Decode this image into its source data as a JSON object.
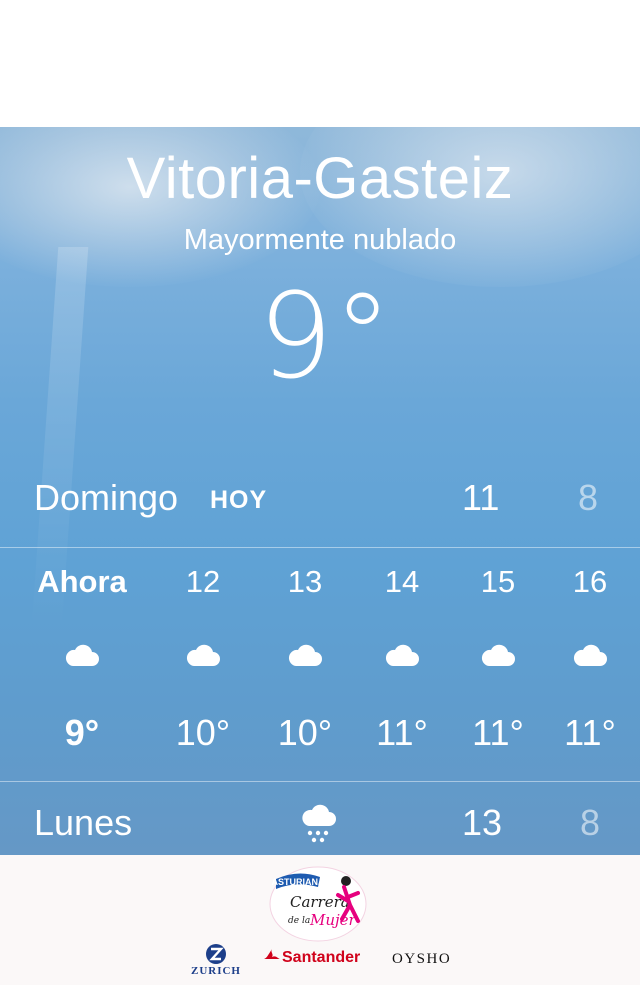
{
  "location": {
    "city": "Vitoria-Gasteiz",
    "condition": "Mayormente nublado",
    "current_temp": "9°"
  },
  "today": {
    "day": "Domingo",
    "badge": "HOY",
    "high": "11",
    "low": "8"
  },
  "hourly": [
    {
      "time": "Ahora",
      "icon": "cloud-icon",
      "temp": "9°"
    },
    {
      "time": "12",
      "icon": "cloud-icon",
      "temp": "10°"
    },
    {
      "time": "13",
      "icon": "cloud-icon",
      "temp": "10°"
    },
    {
      "time": "14",
      "icon": "cloud-icon",
      "temp": "11°"
    },
    {
      "time": "15",
      "icon": "cloud-icon",
      "temp": "11°"
    },
    {
      "time": "16",
      "icon": "cloud-icon",
      "temp": "11°"
    }
  ],
  "next_day": {
    "day": "Lunes",
    "icon": "cloud-rain-icon",
    "high": "13",
    "low": "8"
  },
  "ad": {
    "brand": "ASTURIANA",
    "event_line1": "Carrera",
    "event_line2": "de la",
    "event_line3": "Mujer",
    "sponsors": {
      "zurich": "ZURICH",
      "santander": "Santander",
      "oysho": "OYSHO"
    }
  },
  "colors": {
    "sky_top": "#8fb8da",
    "sky_bottom": "#6598c6",
    "santander_red": "#d0021b",
    "zurich_blue": "#1d3f8a",
    "ad_pink": "#e6007e"
  }
}
